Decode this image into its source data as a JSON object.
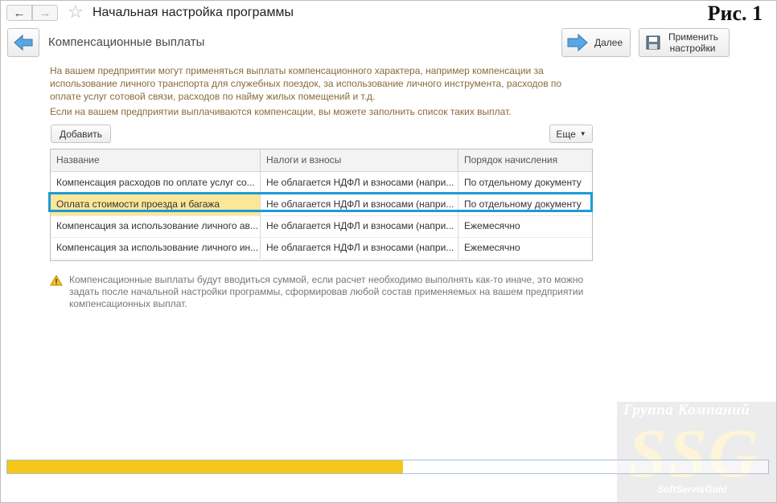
{
  "window": {
    "title": "Начальная настройка программы",
    "figure_label": "Рис. 1"
  },
  "header": {
    "title": "Компенсационные выплаты",
    "next_label": "Далее",
    "apply_label_1": "Применить",
    "apply_label_2": "настройки"
  },
  "description": {
    "p1": "На вашем предприятии могут применяться выплаты компенсационного характера, например компенсации за использование личного транспорта для служебных поездок, за использование личного инструмента, расходов по оплате услуг сотовой связи, расходов по найму жилых помещений и т.д.",
    "p2": "Если на вашем предприятии выплачиваются компенсации, вы можете заполнить список таких выплат."
  },
  "commands": {
    "add_label": "Добавить",
    "more_label": "Еще"
  },
  "table": {
    "columns": [
      "Название",
      "Налоги и взносы",
      "Порядок начисления"
    ],
    "rows": [
      [
        "Компенсация расходов по оплате услуг со...",
        "Не облагается НДФЛ и взносами (напри...",
        "По отдельному документу"
      ],
      [
        "Оплата стоимости проезда и багажа",
        "Не облагается НДФЛ и взносами (напри...",
        "По отдельному документу"
      ],
      [
        "Компенсация за использование личного ав...",
        "Не облагается НДФЛ и взносами (напри...",
        "Ежемесячно"
      ],
      [
        "Компенсация за использование личного ин...",
        "Не облагается НДФЛ и взносами (напри...",
        "Ежемесячно"
      ]
    ],
    "selected_row": 1
  },
  "warning": {
    "text": "Компенсационные выплаты будут вводиться суммой, если расчет необходимо выполнять как-то иначе, это можно задать после начальной настройки программы, сформировав любой состав применяемых на вашем предприятии компенсационных выплат."
  },
  "progress": {
    "value_percent": 52
  },
  "watermark": {
    "line1": "Группа Компаний",
    "big": "SSG",
    "sub": "SoftServisGold"
  },
  "colors": {
    "selected_cell": "#fbe798",
    "row_outline": "#1d9bd6",
    "progress_fill": "#f6c619",
    "description_text": "#8a6a3a"
  }
}
